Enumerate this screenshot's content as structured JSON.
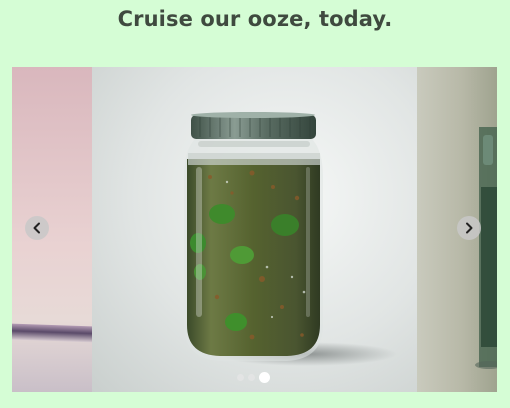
{
  "page": {
    "title": "Cruise our ooze, today."
  },
  "carousel": {
    "previous_icon": "chevron-left-icon",
    "next_icon": "chevron-right-icon",
    "slides": [
      {
        "image": "pink-jar-partial"
      },
      {
        "image": "jar-of-green-ooze-with-moss"
      },
      {
        "image": "green-bottle-partial"
      }
    ],
    "indicators": [
      {
        "active": false
      },
      {
        "active": false
      },
      {
        "active": true
      }
    ]
  }
}
